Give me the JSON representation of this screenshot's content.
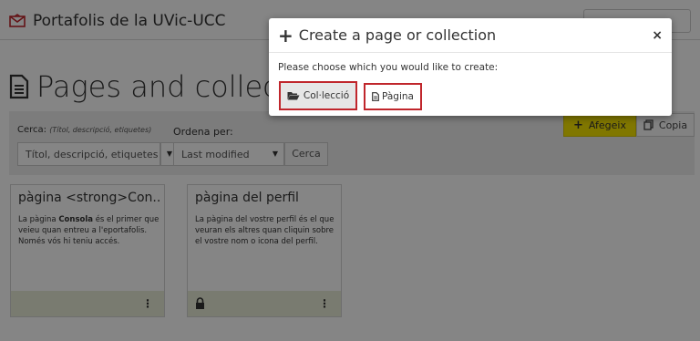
{
  "header": {
    "site_title": "Portafolis de la UVic-UCC"
  },
  "page": {
    "title": "Pages and collections"
  },
  "toolbar": {
    "search_label": "Cerca:",
    "search_hint": "(Títol, descripció, etiquetes)",
    "search_value": "Títol, descripció, etiquetes",
    "sort_label": "Ordena per:",
    "sort_value": "Last modified",
    "search_button": "Cerca",
    "add_button": "Afegeix",
    "copy_button": "Copia"
  },
  "cards": [
    {
      "title": "pàgina <strong>Con...",
      "desc_before": "La pàgina ",
      "desc_bold": "Consola",
      "desc_after": " és el primer que veieu quan entreu a l'eportafolis. Només vós hi teniu accés.",
      "locked": false
    },
    {
      "title": "pàgina del perfil",
      "desc_before": "La pàgina del vostre perfil és el que veuran els altres quan cliquin sobre el vostre nom o icona del perfil.",
      "desc_bold": "",
      "desc_after": "",
      "locked": true
    }
  ],
  "modal": {
    "title": "Create a page or collection",
    "close": "×",
    "text": "Please choose which you would like to create:",
    "collection_button": "Col·lecció",
    "page_button": "Pàgina"
  },
  "colors": {
    "brand_icon": "#c0262c",
    "highlight": "#c0262c",
    "add_button": "#f5e400",
    "card_footer": "#e8ecd6"
  }
}
